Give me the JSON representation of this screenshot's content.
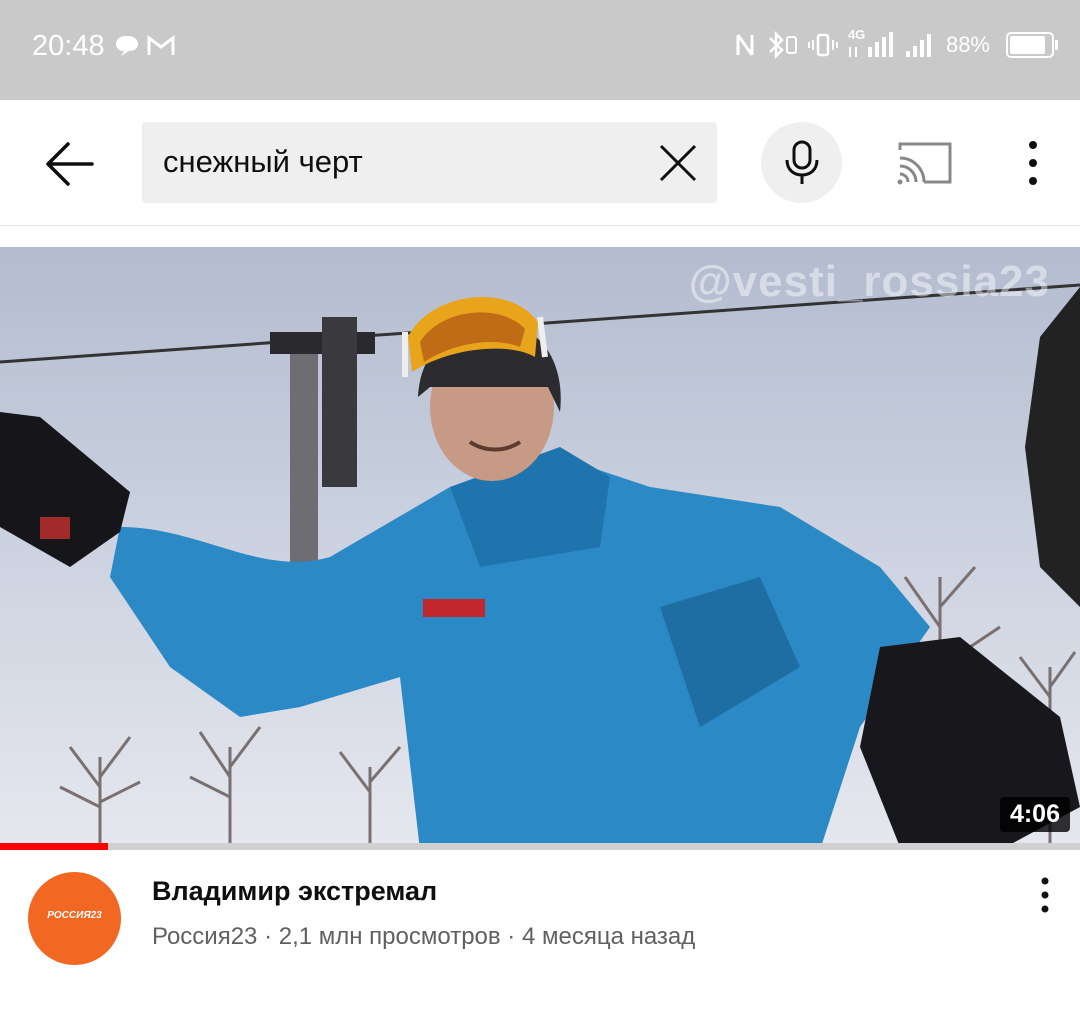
{
  "status_bar": {
    "time": "20:48",
    "battery_percent": "88%",
    "battery_level": 0.88,
    "network_label": "4G"
  },
  "search": {
    "query": "снежный черт",
    "icons": {
      "back": "arrow-left-icon",
      "clear": "close-icon",
      "voice": "microphone-icon",
      "cast": "cast-icon",
      "more": "more-vertical-icon"
    }
  },
  "video": {
    "watermark": "@vesti_rossia23",
    "duration": "4:06",
    "watched_fraction": 0.1,
    "title": "Владимир экстремал",
    "meta": "Россия23 · 2,1 млн просмотров · 4 месяца назад",
    "channel_avatar_text": "РОССИЯ23"
  },
  "colors": {
    "accent": "#ff0000",
    "avatar_bg": "#f26722",
    "status_bar_bg": "#c9c9c9"
  }
}
